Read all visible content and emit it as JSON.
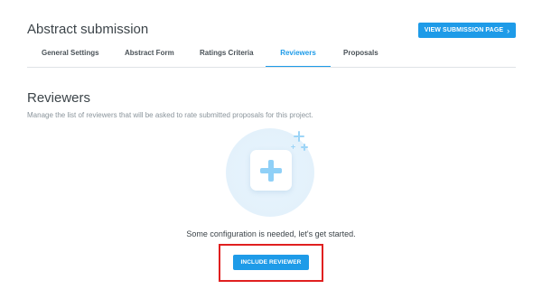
{
  "header": {
    "title": "Abstract submission",
    "view_button": "VIEW SUBMISSION PAGE",
    "view_button_icon": "chevron-right-icon"
  },
  "tabs": [
    {
      "label": "General Settings",
      "active": false
    },
    {
      "label": "Abstract Form",
      "active": false
    },
    {
      "label": "Ratings Criteria",
      "active": false
    },
    {
      "label": "Reviewers",
      "active": true
    },
    {
      "label": "Proposals",
      "active": false
    }
  ],
  "main": {
    "title": "Reviewers",
    "description": "Manage the list of reviewers that will be asked to rate submitted proposals for this project.",
    "illustration_icon": "add-plus-icon",
    "empty_message": "Some configuration is needed, let's get started.",
    "include_button": "INCLUDE REVIEWER"
  },
  "colors": {
    "accent": "#1e9be8",
    "highlight": "#e02020",
    "text": "#3c4449"
  }
}
